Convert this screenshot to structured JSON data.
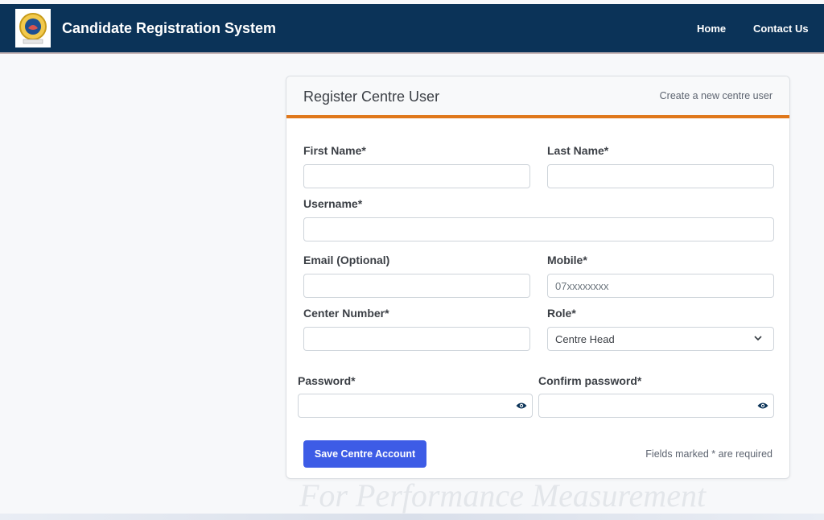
{
  "navbar": {
    "brand": "Candidate Registration System",
    "links": [
      "Home",
      "Contact Us"
    ],
    "bg_color": "#0b3358"
  },
  "card": {
    "title": "Register Centre User",
    "subtitle": "Create a new centre user",
    "accent_color": "#e0781b"
  },
  "form": {
    "first_name_label": "First Name*",
    "last_name_label": "Last Name*",
    "username_label": "Username*",
    "email_label": "Email (Optional)",
    "mobile_label": "Mobile*",
    "mobile_placeholder": "07xxxxxxxx",
    "center_number_label": "Center Number*",
    "role_label": "Role*",
    "role_selected": "Centre Head",
    "password_label": "Password*",
    "confirm_password_label": "Confirm password*",
    "save_label": "Save Centre Account",
    "required_note": "Fields marked * are required",
    "button_color": "#3d5ce6"
  },
  "watermark": "For Performance Measurement",
  "icons": [
    "logo-emblem",
    "chevron-down-icon",
    "eye-icon"
  ]
}
